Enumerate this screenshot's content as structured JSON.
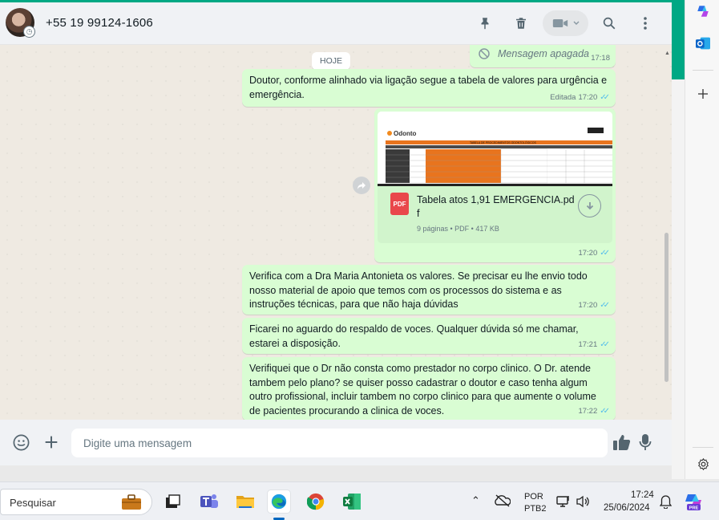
{
  "header": {
    "contact": "+55 19 99124-1606"
  },
  "chat": {
    "date_pill": "HOJE",
    "deleted": {
      "text": "Mensagem apagada",
      "time": "17:18"
    },
    "msg1": {
      "text": "Doutor, conforme alinhado via ligação segue a tabela de valores para urgência e emergência.",
      "edited": "Editada",
      "time": "17:20"
    },
    "file": {
      "icon_label": "PDF",
      "name": "Tabela atos 1,91 EMERGENCIA.pdf",
      "info": "9 páginas • PDF • 417 KB",
      "time": "17:20",
      "thumb_brand": "Odonto",
      "thumb_title": "TABELA DE PROCEDIMENTOS ODONTOLÓGICOS"
    },
    "msg2": {
      "text": "Verifica com a Dra Maria Antonieta os valores. Se precisar eu lhe envio todo nosso material de apoio que temos com os processos do sistema e as instruções técnicas, para que não haja dúvidas",
      "time": "17:20"
    },
    "msg3": {
      "text": "Ficarei no aguardo do respaldo de voces. Qualquer dúvida só me chamar, estarei a disposição.",
      "time": "17:21"
    },
    "msg4": {
      "text": "Verifiquei que o Dr não consta como prestador no corpo clinico. O Dr. atende tambem pelo plano? se quiser posso cadastrar o doutor e caso tenha algum outro profissional, incluir tambem no corpo clinico para que aumente o volume de pacientes procurando a clinica de voces.",
      "time": "17:22"
    }
  },
  "composer": {
    "placeholder": "Digite uma mensagem"
  },
  "taskbar": {
    "search_placeholder": "Pesquisar",
    "lang_top": "POR",
    "lang_bottom": "PTB2",
    "time": "17:24",
    "date": "25/06/2024",
    "copilot_badge": "PRE"
  },
  "colors": {
    "accent": "#00a884",
    "bubble_out": "#d9fdd3",
    "chat_bg": "#efeae2",
    "read_ticks": "#53bdeb"
  }
}
